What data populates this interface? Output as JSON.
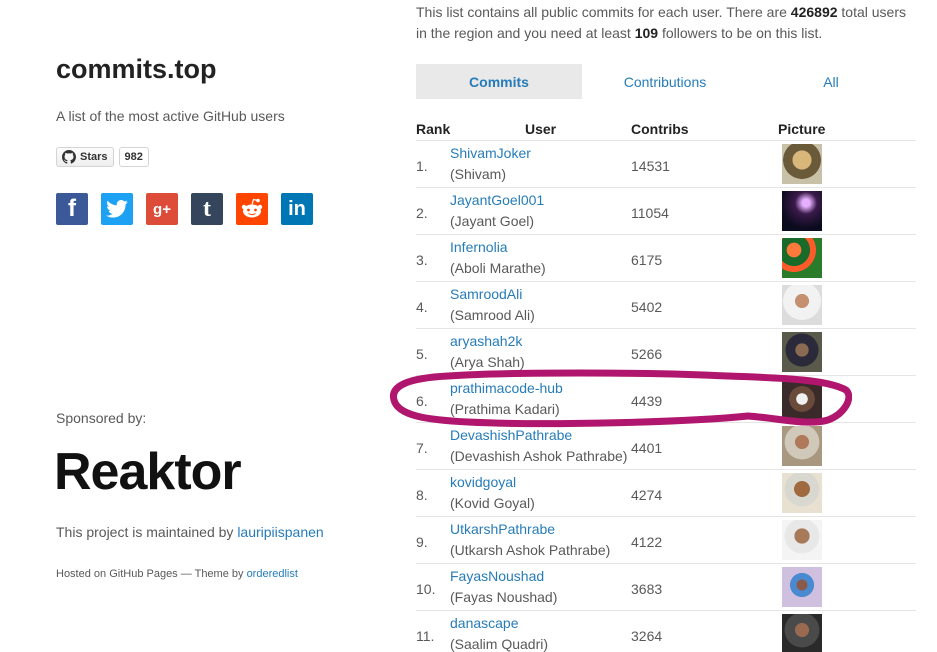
{
  "sidebar": {
    "title": "commits.top",
    "description": "A list of the most active GitHub users",
    "github_button": {
      "label": "Stars",
      "count": "982"
    },
    "social_icons": [
      "facebook-icon",
      "twitter-icon",
      "google-plus-icon",
      "tumblr-icon",
      "reddit-icon",
      "linkedin-icon"
    ],
    "sponsored_label": "Sponsored by:",
    "sponsor_logo_text": "Reaktor",
    "maintained_prefix": "This project is maintained by ",
    "maintainer": "lauripiispanen",
    "hosted_prefix": "Hosted on GitHub Pages — Theme by ",
    "theme_author": "orderedlist"
  },
  "intro": {
    "part1": "This list contains all public commits for each user. There are ",
    "total_users": "426892",
    "part2": " total users in the region and you need at least ",
    "min_followers": "109",
    "part3": " followers to be on this list."
  },
  "tabs": [
    {
      "label": "Commits",
      "active": true
    },
    {
      "label": "Contributions",
      "active": false
    },
    {
      "label": "All",
      "active": false
    }
  ],
  "table": {
    "headers": {
      "rank": "Rank",
      "user": "User",
      "contribs": "Contribs",
      "picture": "Picture"
    },
    "rows": [
      {
        "rank": "1.",
        "user": "ShivamJoker",
        "name": "(Shivam)",
        "contribs": "14531"
      },
      {
        "rank": "2.",
        "user": "JayantGoel001",
        "name": "(Jayant Goel)",
        "contribs": "11054"
      },
      {
        "rank": "3.",
        "user": "Infernolia",
        "name": "(Aboli Marathe)",
        "contribs": "6175"
      },
      {
        "rank": "4.",
        "user": "SamroodAli",
        "name": "(Samrood Ali)",
        "contribs": "5402"
      },
      {
        "rank": "5.",
        "user": "aryashah2k",
        "name": "(Arya Shah)",
        "contribs": "5266"
      },
      {
        "rank": "6.",
        "user": "prathimacode-hub",
        "name": "(Prathima Kadari)",
        "contribs": "4439"
      },
      {
        "rank": "7.",
        "user": "DevashishPathrabe",
        "name": "(Devashish Ashok Pathrabe)",
        "contribs": "4401"
      },
      {
        "rank": "8.",
        "user": "kovidgoyal",
        "name": "(Kovid Goyal)",
        "contribs": "4274"
      },
      {
        "rank": "9.",
        "user": "UtkarshPathrabe",
        "name": "(Utkarsh Ashok Pathrabe)",
        "contribs": "4122"
      },
      {
        "rank": "10.",
        "user": "FayasNoushad",
        "name": "(Fayas Noushad)",
        "contribs": "3683"
      },
      {
        "rank": "11.",
        "user": "danascape",
        "name": "(Saalim Quadri)",
        "contribs": "3264"
      }
    ]
  },
  "colors": {
    "link": "#267CB9",
    "highlight_stroke": "#b0166e",
    "active_tab_bg": "#e9e9e9"
  }
}
